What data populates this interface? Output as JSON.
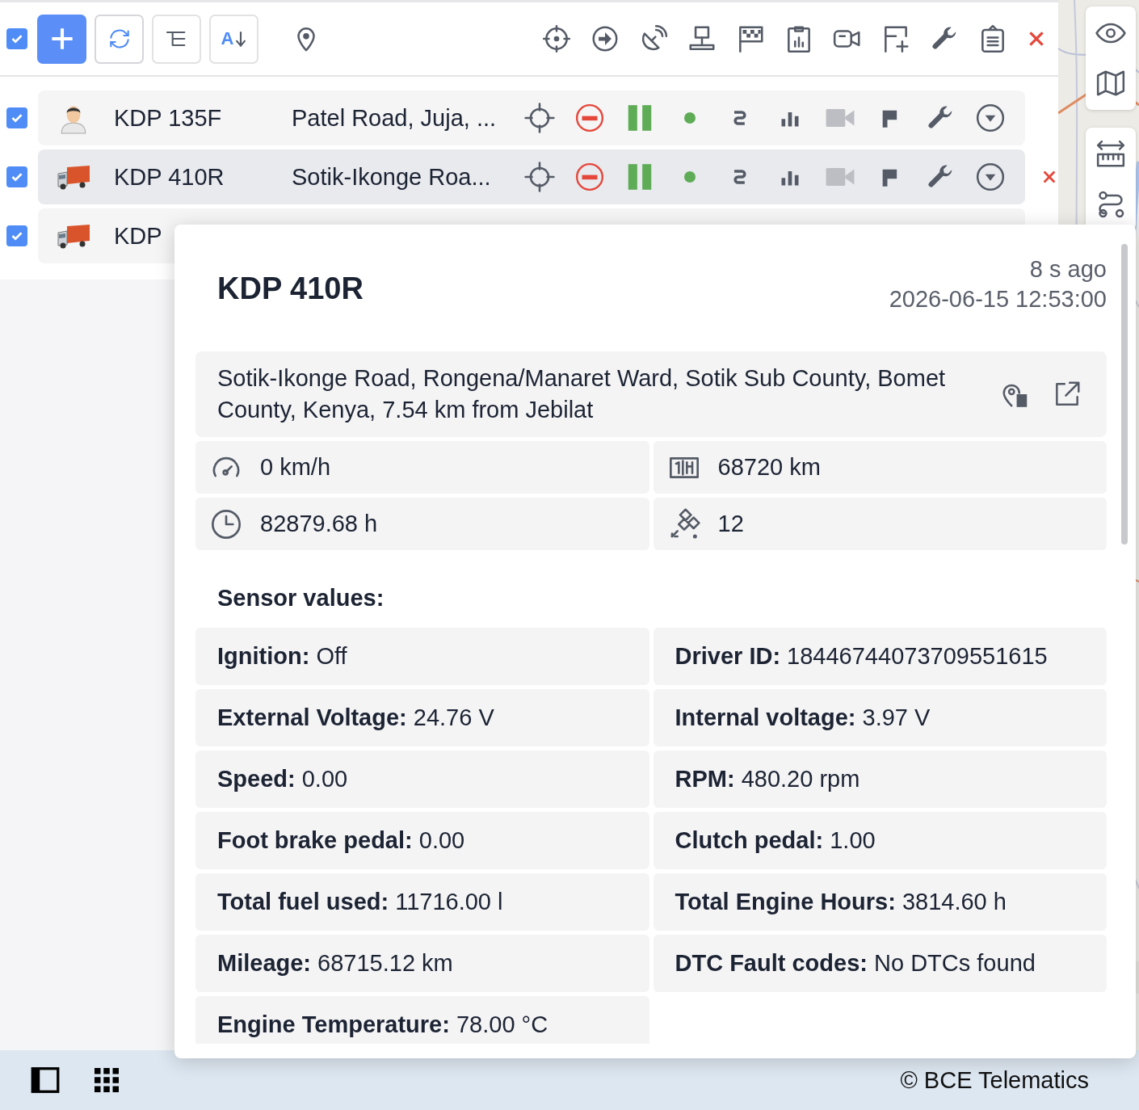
{
  "toolbar": {
    "all_checked": true,
    "sort_label": "A"
  },
  "objects": [
    {
      "kind": "driver",
      "name": "KDP 135F",
      "address": "Patel Road, Juja, ...",
      "checked": true,
      "selected": false
    },
    {
      "kind": "truck",
      "name": "KDP 410R",
      "address": "Sotik-Ikonge Roa...",
      "checked": true,
      "selected": true
    },
    {
      "kind": "truck",
      "name": "KDP",
      "checked": true,
      "selected": false
    }
  ],
  "popup": {
    "title": "KDP 410R",
    "age": "8 s ago",
    "timestamp": "2026-06-15 12:53:00",
    "address": "Sotik-Ikonge Road, Rongena/Manaret Ward, Sotik Sub County, Bomet County, Kenya, 7.54 km from Jebilat",
    "stats": [
      {
        "kind": "speed",
        "value": "0 km/h"
      },
      {
        "kind": "odometer",
        "value": "68720 km"
      },
      {
        "kind": "engine_hours",
        "value": "82879.68 h"
      },
      {
        "kind": "satellites",
        "value": "12"
      }
    ],
    "sensors_title": "Sensor values:",
    "sensors": [
      {
        "label": "Ignition:",
        "value": "Off"
      },
      {
        "label": "Driver ID:",
        "value": "18446744073709551615"
      },
      {
        "label": "External Voltage:",
        "value": "24.76 V"
      },
      {
        "label": "Internal voltage:",
        "value": "3.97 V"
      },
      {
        "label": "Speed:",
        "value": "0.00"
      },
      {
        "label": "RPM:",
        "value": "480.20 rpm"
      },
      {
        "label": "Foot brake pedal:",
        "value": "0.00"
      },
      {
        "label": "Clutch pedal:",
        "value": "1.00"
      },
      {
        "label": "Total fuel used:",
        "value": "11716.00 l"
      },
      {
        "label": "Total Engine Hours:",
        "value": "3814.60 h"
      },
      {
        "label": "Mileage:",
        "value": "68715.12 km"
      },
      {
        "label": "DTC Fault codes:",
        "value": "No DTCs found"
      },
      {
        "label": "Engine Temperature:",
        "value": "78.00 °C"
      }
    ]
  },
  "footer": {
    "copyright": "© BCE Telematics"
  }
}
